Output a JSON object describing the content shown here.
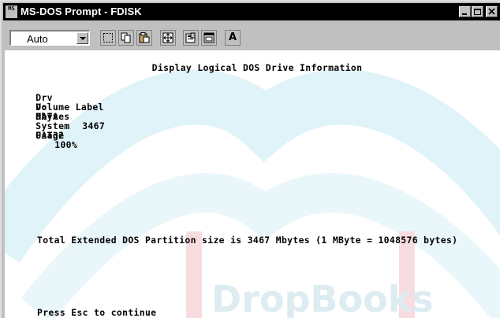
{
  "window": {
    "title": "MS-DOS Prompt - FDISK",
    "app_icon_text": "MS"
  },
  "toolbar": {
    "font_size_value": "Auto",
    "font_button_label": "A",
    "tools": [
      "mark-icon",
      "copy-icon",
      "paste-icon",
      "fullscreen-icon",
      "properties-icon",
      "background-icon",
      "font-icon"
    ]
  },
  "console": {
    "heading": "Display Logical DOS Drive Information",
    "columns": [
      "Drv",
      "Volume Label",
      "Mbytes",
      "System",
      "Usage"
    ],
    "rows": [
      {
        "drv": "D:",
        "label": "DATA",
        "mbytes": "3467",
        "system": "FAT32",
        "usage": "100%"
      }
    ],
    "total_prefix": "Total Extended DOS Partition size is ",
    "total_value": "3467",
    "total_suffix": " Mbytes (1 MByte = 1048576 bytes)",
    "prompt_prefix": "Press ",
    "prompt_key": "Esc",
    "prompt_suffix": " to continue"
  },
  "watermark": {
    "text": "DropBooks",
    "color": "#9fd8e6",
    "accent": "#e8a0a8"
  }
}
